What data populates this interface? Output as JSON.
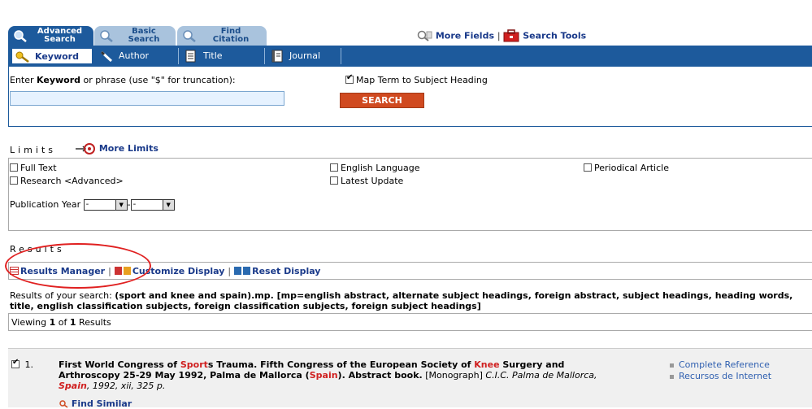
{
  "tabs": {
    "advanced": {
      "line1": "Advanced",
      "line2": "Search"
    },
    "basic": {
      "line1": "Basic",
      "line2": "Search"
    },
    "find": {
      "line1": "Find",
      "line2": "Citation"
    }
  },
  "tools": {
    "more_fields": "More Fields",
    "search_tools": "Search Tools"
  },
  "field_tabs": {
    "keyword": "Keyword",
    "author": "Author",
    "title": "Title",
    "journal": "Journal"
  },
  "search": {
    "label_prefix": "Enter ",
    "label_bold": "Keyword",
    "label_suffix": " or phrase (use \"$\" for truncation):",
    "input_value": "",
    "map_term": "Map Term to Subject Heading",
    "button": "SEARCH"
  },
  "limits": {
    "title": "Limits",
    "more_limits": "More Limits",
    "full_text": "Full Text",
    "research": "Research <Advanced>",
    "english": "English Language",
    "latest": "Latest Update",
    "periodical": "Periodical Article",
    "pub_year_label": "Publication Year",
    "year_from": "-",
    "year_to": "-"
  },
  "results": {
    "title": "Results",
    "manager": "Results Manager",
    "customize": "Customize Display",
    "reset": "Reset Display",
    "query_prefix": "Results of your search: ",
    "query_text": "(sport and knee and spain).mp. [mp=english abstract, alternate subject headings, foreign abstract, subject headings, heading words, title, english classification subjects, foreign classification subjects, foreign subject headings]",
    "viewing_prefix": "Viewing ",
    "viewing_from": "1",
    "viewing_mid": " of ",
    "viewing_total": "1",
    "viewing_suffix": " Results"
  },
  "record": {
    "number": "1.",
    "t1": "First World Congress of ",
    "hl1": "Sport",
    "t2": "s Trauma. Fifth Congress of the European Society of ",
    "hl2": "Knee",
    "t3": " Surgery and Arthroscopy 25-29 May 1992, Palma de Mallorca (",
    "hl3": "Spain",
    "t4": "). Abstract book.",
    "type": " [Monograph] ",
    "src1": "C.I.C. Palma de Mallorca, ",
    "src_hl": "Spain",
    "src2": ", 1992, xii, 325 p.",
    "link1": "Complete Reference",
    "link2": "Recursos de Internet",
    "find_similar": "Find Similar"
  },
  "colors": {
    "brand_blue": "#1d5a9c",
    "search_button": "#d04a20",
    "highlight": "#d02020",
    "annotation_circle": "#e02020"
  }
}
